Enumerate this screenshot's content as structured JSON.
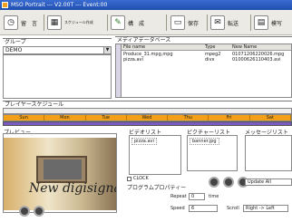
{
  "window": {
    "title": "MSO Portrait --- V2.00T --- Event:00"
  },
  "toolbar": {
    "buttons": [
      {
        "label": "留　言",
        "icon": "clock-icon"
      },
      {
        "label": "スケジュール作成",
        "icon": "schedule-icon"
      },
      {
        "label": "構　成",
        "icon": "compose-icon"
      },
      {
        "label": "保存",
        "icon": "save-icon"
      },
      {
        "label": "転送",
        "icon": "transfer-icon"
      },
      {
        "label": "模写",
        "icon": "print-icon"
      }
    ]
  },
  "group": {
    "label": "グループ",
    "selected": "DEMO"
  },
  "media_db": {
    "label": "メディアデータベース",
    "columns": [
      "File name",
      "Type",
      "New Name"
    ],
    "rows": [
      {
        "file": "Produce_31.mpg,mpg",
        "type": "mpeg2",
        "new_name": "01071206220026.mpg"
      },
      {
        "file": "pizza.avi",
        "type": "divx",
        "new_name": "01000626110403.avi"
      }
    ]
  },
  "schedule": {
    "label": "プレイヤースケジュール",
    "days": [
      "Sun",
      "Mon",
      "Tue",
      "Wed",
      "Thu",
      "Fri",
      "Sat"
    ]
  },
  "preview": {
    "label": "プレビュー",
    "overlay_text": "New digisigna"
  },
  "video_list": {
    "label": "ビデオリスト",
    "items": [
      "pizza.avi"
    ]
  },
  "picture_list": {
    "label": "ピクチャーリスト",
    "items": [
      "banner.jpg"
    ]
  },
  "message_list": {
    "label": "メッセージリスト",
    "items": []
  },
  "clock_check": {
    "label": "CLOCK",
    "checked": false
  },
  "program_props": {
    "label": "プログラムプロパティー"
  },
  "update": {
    "label": "Update All"
  },
  "repeat": {
    "label": "Repeat",
    "value": "0",
    "unit": "time"
  },
  "speed": {
    "label": "Speed",
    "value": "6"
  },
  "scroll": {
    "label": "Scroll",
    "value": "Right -> Left"
  },
  "colors": {
    "accent": "#f3a018",
    "track": "#7a5cc0",
    "titlebar": "#1f4fb0"
  }
}
